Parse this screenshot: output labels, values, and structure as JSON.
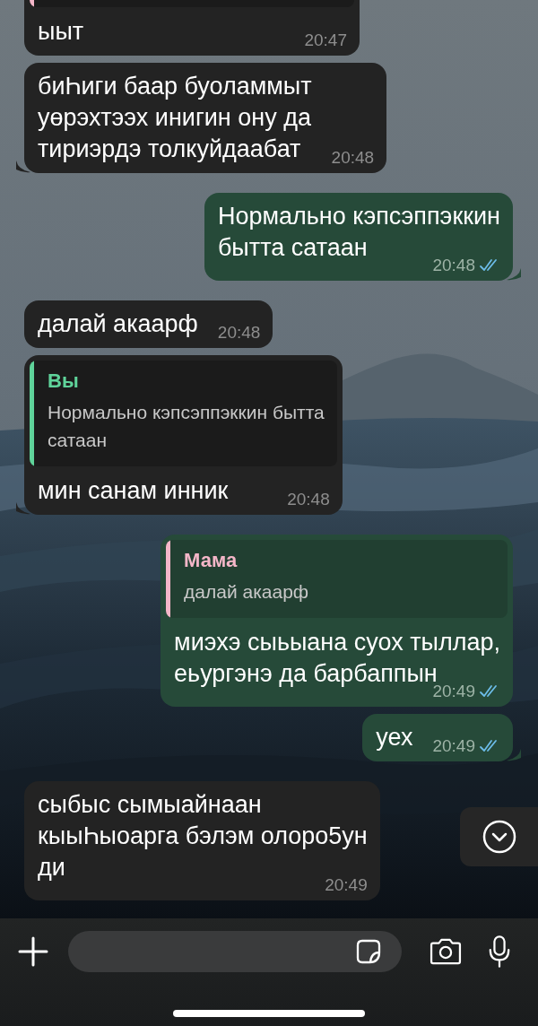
{
  "messages": [
    {
      "kind": "incoming",
      "tail": false,
      "quote": {
        "color": "#f4b6c8"
      },
      "lines": [
        "ыыт"
      ],
      "time": "20:47"
    },
    {
      "kind": "incoming",
      "tail": true,
      "lines": [
        "биҺиги баар буоламмыт",
        "уөрэхтээх инигин ону да",
        "тириэрдэ толкуйдаабат"
      ],
      "time": "20:48"
    },
    {
      "kind": "outgoing",
      "tail": true,
      "read": true,
      "lines": [
        "Нормально кэпсэппэккин",
        "бытта сатаан"
      ],
      "time": "20:48"
    },
    {
      "kind": "incoming",
      "tail": false,
      "lines": [
        "далай акаарф"
      ],
      "time": "20:48"
    },
    {
      "kind": "incoming",
      "tail": true,
      "quote": {
        "color": "#5fd39a",
        "author": "Вы",
        "lines": [
          "Нормально кэпсэппэккин бытта",
          "сатаан"
        ]
      },
      "lines": [
        "мин санам инник"
      ],
      "time": "20:48"
    },
    {
      "kind": "outgoing",
      "tail": false,
      "read": true,
      "quote": {
        "color": "#f4b6c8",
        "author": "Мама",
        "lines": [
          "далай акаарф"
        ]
      },
      "lines": [
        "миэхэ сыьыана суох тыллар,",
        "еьургэнэ да барбаппын"
      ],
      "time": "20:49"
    },
    {
      "kind": "outgoing",
      "tail": true,
      "read": true,
      "lines": [
        "уех"
      ],
      "time": "20:49"
    },
    {
      "kind": "incoming",
      "tail": false,
      "lines": [
        "сыбыс сымыайнаан",
        "кыыҺыоарга бэлэм олоро5ун",
        "ди"
      ],
      "time": "20:49"
    }
  ],
  "composer": {
    "scroll_down_button": true
  }
}
